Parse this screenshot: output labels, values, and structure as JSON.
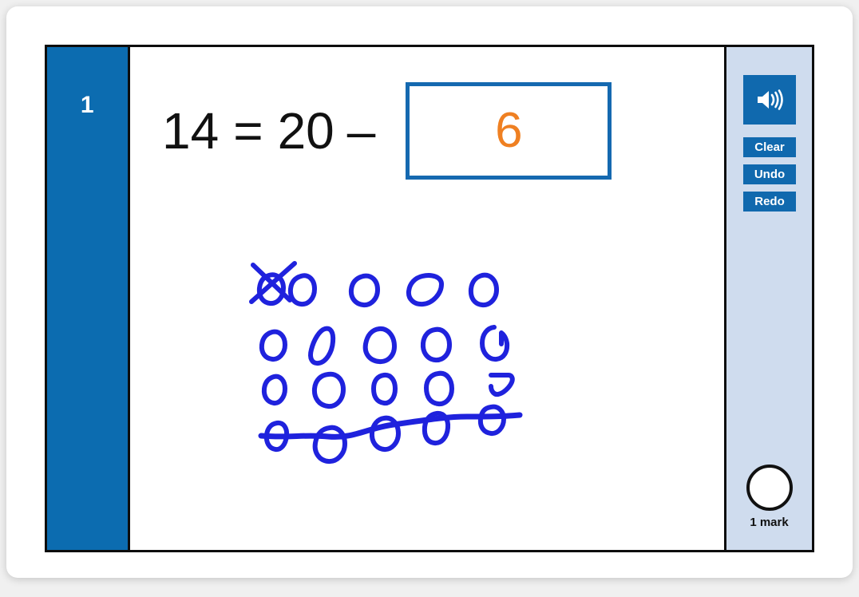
{
  "question": {
    "number": "1",
    "equation": {
      "left_operand": "14",
      "equals_sign": "=",
      "right_operand": "20",
      "minus_sign": "–",
      "answer_value": "6",
      "full_text": "14 = 20 – 6"
    },
    "answer_color": "#ef8022",
    "marks": {
      "circle_filled": false,
      "label": "1 mark"
    }
  },
  "toolbar": {
    "audio_label": "speaker-icon",
    "clear_label": "Clear",
    "undo_label": "Undo",
    "redo_label": "Redo"
  },
  "colors": {
    "sidebar_blue": "#0c6cb0",
    "button_blue": "#1069ae",
    "panel_blue": "#cfdcee",
    "answer_border": "#1569b0",
    "answer_orange": "#ef8022",
    "ink_blue": "#1f22dd",
    "frame_black": "#0d0d0d",
    "page_background": "#f0f0f0"
  },
  "drawing": {
    "description": "hand-drawn grid of 20 circles; first circle crossed out with an X and the bottom row of 5 circles struck through with a wavy line",
    "total_circles": 20,
    "crossed_out": 6,
    "remaining": 14,
    "ink_color": "#1f22dd"
  }
}
